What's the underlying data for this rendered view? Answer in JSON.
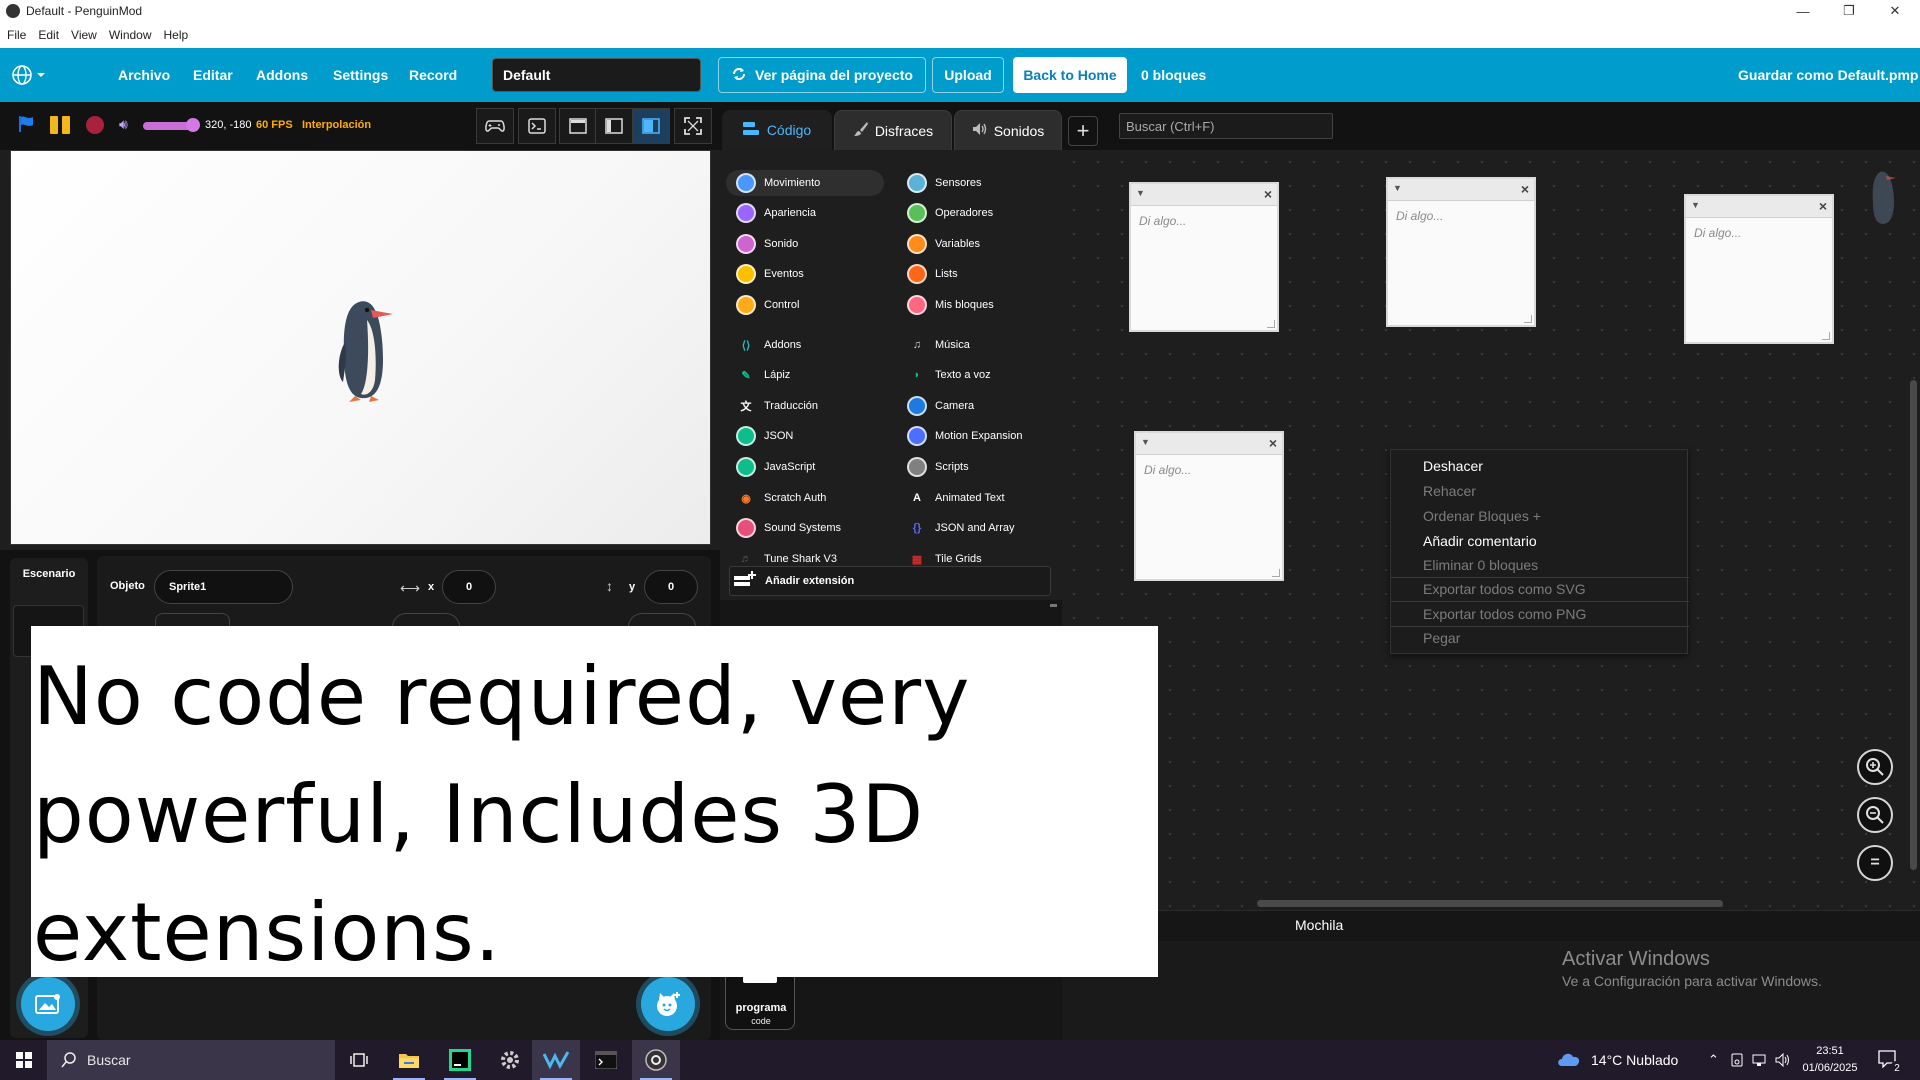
{
  "window": {
    "title": "Default - PenguinMod",
    "minimize": "—",
    "maximize": "❐",
    "close": "✕"
  },
  "menubar": [
    "File",
    "Edit",
    "View",
    "Window",
    "Help"
  ],
  "topbar": {
    "menu": [
      "Archivo",
      "Editar",
      "Addons",
      "Settings",
      "Record"
    ],
    "project_title": "Default",
    "view_project_page": "Ver página del proyecto",
    "upload": "Upload",
    "back_home": "Back to Home",
    "block_count": "0 bloques",
    "save_as": "Guardar como Default.pmp",
    "accent": "#009ccc"
  },
  "stage_header": {
    "coords": "320, -180",
    "fps": "60 FPS",
    "interpolation": "Interpolación",
    "volume_level": 0.85
  },
  "tabs": {
    "code": "Código",
    "costumes": "Disfraces",
    "sounds": "Sonidos",
    "search_placeholder": "Buscar (Ctrl+F)"
  },
  "categories": {
    "left": [
      {
        "label": "Movimiento",
        "color": "#4c97ff",
        "icon": "dot"
      },
      {
        "label": "Apariencia",
        "color": "#9966ff",
        "icon": "dot"
      },
      {
        "label": "Sonido",
        "color": "#cf63cf",
        "icon": "dot"
      },
      {
        "label": "Eventos",
        "color": "#ffbf00",
        "icon": "dot"
      },
      {
        "label": "Control",
        "color": "#ffab19",
        "icon": "dot"
      },
      {
        "label": "Addons",
        "color": "#29beb8",
        "icon": "addons-icon"
      },
      {
        "label": "Lápiz",
        "color": "#0fbd8c",
        "icon": "pen-icon"
      },
      {
        "label": "Traducción",
        "color": "#ffffff",
        "icon": "translate-icon"
      },
      {
        "label": "JSON",
        "color": "#0fbd8c",
        "icon": "dot"
      },
      {
        "label": "JavaScript",
        "color": "#0fbd8c",
        "icon": "dot"
      },
      {
        "label": "Scratch Auth",
        "color": "#ff7b26",
        "icon": "scratch-auth-icon"
      },
      {
        "label": "Sound Systems",
        "color": "#e84f7a",
        "icon": "dot"
      },
      {
        "label": "Tune Shark V3",
        "color": "#555555",
        "icon": "tune-shark-icon"
      }
    ],
    "right": [
      {
        "label": "Sensores",
        "color": "#5cb1d6",
        "icon": "dot"
      },
      {
        "label": "Operadores",
        "color": "#59c059",
        "icon": "dot"
      },
      {
        "label": "Variables",
        "color": "#ff8c1a",
        "icon": "dot"
      },
      {
        "label": "Lists",
        "color": "#ff661a",
        "icon": "dot"
      },
      {
        "label": "Mis bloques",
        "color": "#ff6680",
        "icon": "dot"
      },
      {
        "label": "Música",
        "color": "#cfcfcf",
        "icon": "music-icon"
      },
      {
        "label": "Texto a voz",
        "color": "#0fbd8c",
        "icon": "text-to-speech-icon"
      },
      {
        "label": "Camera",
        "color": "#1f7ae0",
        "icon": "dot"
      },
      {
        "label": "Motion Expansion",
        "color": "#4c6fff",
        "icon": "dot"
      },
      {
        "label": "Scripts",
        "color": "#808080",
        "icon": "dot"
      },
      {
        "label": "Animated Text",
        "color": "#ffffff",
        "icon": "animated-text-icon"
      },
      {
        "label": "JSON and Array",
        "color": "#5b66f5",
        "icon": "json-array-icon"
      },
      {
        "label": "Tile Grids",
        "color": "#cc2b2b",
        "icon": "tile-grids-icon"
      }
    ],
    "add_extension": "Añadir extensión"
  },
  "sprite_info": {
    "stage_label": "Escenario",
    "object_label": "Objeto",
    "sprite_name": "Sprite1",
    "x_label": "x",
    "x_value": "0",
    "y_label": "y",
    "y_value": "0"
  },
  "notes": [
    {
      "placeholder": "Di algo..."
    },
    {
      "placeholder": "Di algo..."
    },
    {
      "placeholder": "Di algo..."
    },
    {
      "placeholder": "Di algo..."
    }
  ],
  "context_menu": [
    {
      "label": "Deshacer",
      "enabled": true
    },
    {
      "label": "Rehacer",
      "enabled": false
    },
    {
      "label": "Ordenar Bloques +",
      "enabled": false
    },
    {
      "label": "Añadir comentario",
      "enabled": true
    },
    {
      "label": "Eliminar 0 bloques",
      "enabled": false
    },
    {
      "label": "Exportar todos como SVG",
      "enabled": false
    },
    {
      "label": "Exportar todos como PNG",
      "enabled": false
    },
    {
      "label": "Pegar",
      "enabled": false
    }
  ],
  "zoom": {
    "in": "+",
    "out": "−",
    "reset": "="
  },
  "backpack": {
    "title": "Mochila",
    "item_name": "programa",
    "item_sub": "code"
  },
  "watermark": {
    "title": "Activar Windows",
    "subtitle": "Ve a Configuración para activar Windows."
  },
  "caption": "No code required, very powerful, Includes 3D extensions.",
  "taskbar": {
    "search": "Buscar",
    "weather": "14°C  Nublado",
    "time": "23:51",
    "date": "01/06/2025",
    "notif_count": "2"
  }
}
